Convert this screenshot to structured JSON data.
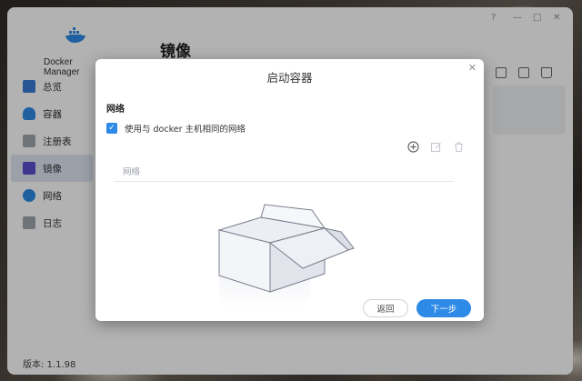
{
  "app": {
    "name": "Docker Manager",
    "page_title": "镜像",
    "version": "版本: 1.1.98",
    "window_controls": [
      "?",
      "—",
      "□",
      "✕"
    ]
  },
  "sidebar": {
    "items": [
      {
        "label": "总览",
        "icon": "overview-icon",
        "color": "#3a7bd5"
      },
      {
        "label": "容器",
        "icon": "container-icon",
        "color": "#2d8ae6"
      },
      {
        "label": "注册表",
        "icon": "registry-icon",
        "color": "#8a8f99"
      },
      {
        "label": "镜像",
        "icon": "image-icon",
        "color": "#5a4fcf",
        "active": true
      },
      {
        "label": "网络",
        "icon": "network-icon",
        "color": "#2d8ae6"
      },
      {
        "label": "日志",
        "icon": "log-icon",
        "color": "#8a8f99"
      }
    ]
  },
  "toolbar": {
    "icons": [
      "check-edit-icon",
      "export-icon",
      "trash-icon"
    ]
  },
  "dialog": {
    "title": "启动容器",
    "close": "✕",
    "section": "网络",
    "checkbox_label": "使用与 docker 主机相同的网络",
    "checkbox_checked": true,
    "table_column": "网络",
    "table_icons": [
      "add-icon",
      "edit-icon",
      "delete-icon"
    ],
    "back_label": "返回",
    "next_label": "下一步"
  },
  "colors": {
    "accent": "#2d8ae6",
    "overlay": "rgba(0,0,0,0.30)"
  }
}
